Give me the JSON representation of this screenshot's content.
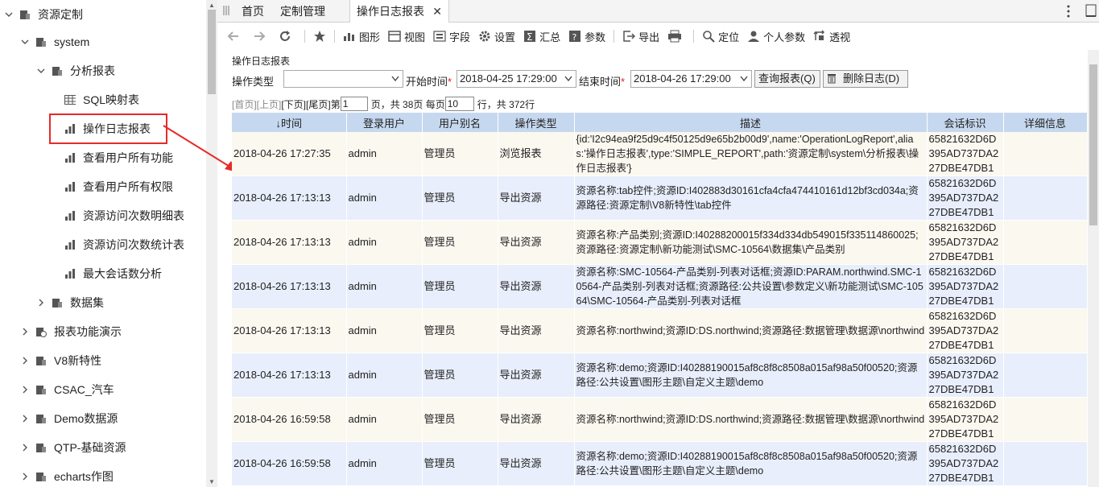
{
  "sidebar": {
    "root": {
      "label": "资源定制"
    },
    "system": {
      "label": "system"
    },
    "analysis": {
      "label": "分析报表"
    },
    "items": [
      {
        "label": "SQL映射表"
      },
      {
        "label": "操作日志报表"
      },
      {
        "label": "查看用户所有功能"
      },
      {
        "label": "查看用户所有权限"
      },
      {
        "label": "资源访问次数明细表"
      },
      {
        "label": "资源访问次数统计表"
      },
      {
        "label": "最大会话数分析"
      }
    ],
    "dataset": {
      "label": "数据集"
    },
    "top": [
      {
        "label": "报表功能演示"
      },
      {
        "label": "V8新特性"
      },
      {
        "label": "CSAC_汽车"
      },
      {
        "label": "Demo数据源"
      },
      {
        "label": "QTP-基础资源"
      },
      {
        "label": "echarts作图"
      }
    ]
  },
  "tabs": [
    {
      "label": "首页"
    },
    {
      "label": "定制管理"
    },
    {
      "label": "操作日志报表"
    }
  ],
  "toolbar": {
    "graph": "图形",
    "view": "视图",
    "field": "字段",
    "settings": "设置",
    "summary": "汇总",
    "params": "参数",
    "export": "导出",
    "locate": "定位",
    "personal": "个人参数",
    "pivot": "透视"
  },
  "report": {
    "title": "操作日志报表",
    "op_type_label": "操作类型",
    "op_type_value": "",
    "start_label": "开始时间",
    "start_value": "2018-04-25 17:29:00",
    "end_label": "结束时间",
    "end_value": "2018-04-26 17:29:00",
    "query_btn": "查询报表(Q)",
    "delete_btn": "删除日志(D)",
    "req_mark": "*"
  },
  "pager": {
    "first": "[首页]",
    "prev": "[上页]",
    "next": "[下页]",
    "last": "[尾页]",
    "page_prefix": "第",
    "page": "1",
    "page_total_text": "页，共 38页 每页",
    "per_page": "10",
    "rows_text": "行，共 372行"
  },
  "table": {
    "headers": [
      "↓时间",
      "登录用户",
      "用户别名",
      "操作类型",
      "描述",
      "会话标识",
      "详细信息"
    ],
    "rows": [
      {
        "time": "2018-04-26  17:27:35",
        "user": "admin",
        "alias": "管理员",
        "op": "浏览报表",
        "desc": "{id:'I2c94ea9f25d9c4f50125d9e65b2b00d9',name:'OperationLogReport',alias:'操作日志报表',type:'SIMPLE_REPORT',path:'资源定制\\system\\分析报表\\操作日志报表'}",
        "sess": "65821632D6D395AD737DA227DBE47DB1",
        "detail": ""
      },
      {
        "time": "2018-04-26  17:13:13",
        "user": "admin",
        "alias": "管理员",
        "op": "导出资源",
        "desc": "资源名称:tab控件;资源ID:I402883d30161cfa4cfa474410161d12bf3cd034a;资源路径:资源定制\\V8新特性\\tab控件",
        "sess": "65821632D6D395AD737DA227DBE47DB1",
        "detail": ""
      },
      {
        "time": "2018-04-26  17:13:13",
        "user": "admin",
        "alias": "管理员",
        "op": "导出资源",
        "desc": "资源名称:产品类别;资源ID:I40288200015f334d334db549015f335114860025;资源路径:资源定制\\新功能测试\\SMC-10564\\数据集\\产品类别",
        "sess": "65821632D6D395AD737DA227DBE47DB1",
        "detail": ""
      },
      {
        "time": "2018-04-26  17:13:13",
        "user": "admin",
        "alias": "管理员",
        "op": "导出资源",
        "desc": "资源名称:SMC-10564-产品类别-列表对话框;资源ID:PARAM.northwind.SMC-10564-产品类别-列表对话框;资源路径:公共设置\\参数定义\\新功能测试\\SMC-10564\\SMC-10564-产品类别-列表对话框",
        "sess": "65821632D6D395AD737DA227DBE47DB1",
        "detail": ""
      },
      {
        "time": "2018-04-26  17:13:13",
        "user": "admin",
        "alias": "管理员",
        "op": "导出资源",
        "desc": "资源名称:northwind;资源ID:DS.northwind;资源路径:数据管理\\数据源\\northwind",
        "sess": "65821632D6D395AD737DA227DBE47DB1",
        "detail": ""
      },
      {
        "time": "2018-04-26  17:13:13",
        "user": "admin",
        "alias": "管理员",
        "op": "导出资源",
        "desc": "资源名称:demo;资源ID:I40288190015af8c8f8c8508a015af98a50f00520;资源路径:公共设置\\图形主题\\自定义主题\\demo",
        "sess": "65821632D6D395AD737DA227DBE47DB1",
        "detail": ""
      },
      {
        "time": "2018-04-26  16:59:58",
        "user": "admin",
        "alias": "管理员",
        "op": "导出资源",
        "desc": "资源名称:northwind;资源ID:DS.northwind;资源路径:数据管理\\数据源\\northwind",
        "sess": "65821632D6D395AD737DA227DBE47DB1",
        "detail": ""
      },
      {
        "time": "2018-04-26  16:59:58",
        "user": "admin",
        "alias": "管理员",
        "op": "导出资源",
        "desc": "资源名称:demo;资源ID:I40288190015af8c8f8c8508a015af98a50f00520;资源路径:公共设置\\图形主题\\自定义主题\\demo",
        "sess": "65821632D6D395AD737DA227DBE47DB1",
        "detail": ""
      }
    ]
  },
  "colors": {
    "header_bg": "#c6d8ef",
    "row_odd": "#fbf8f0",
    "row_even": "#e8eefb",
    "highlight": "#e52a2a"
  }
}
